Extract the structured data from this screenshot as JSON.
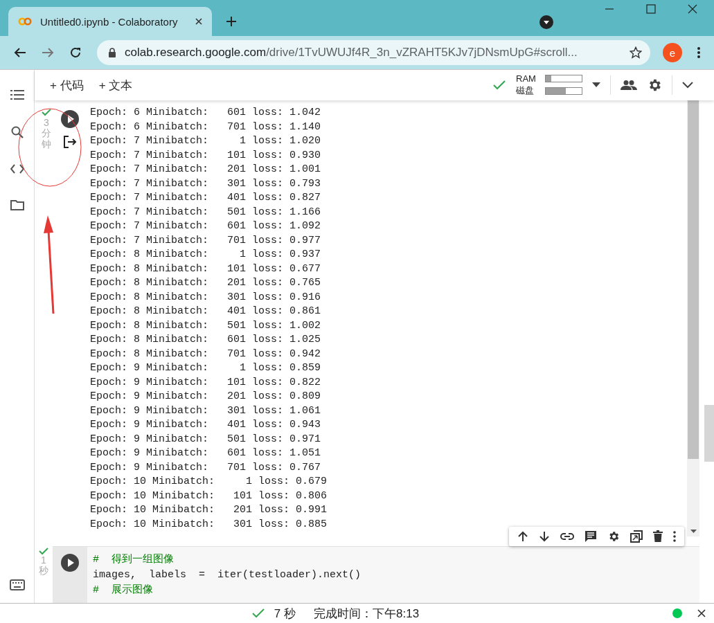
{
  "browser": {
    "tab_title": "Untitled0.ipynb - Colaboratory",
    "url_host": "colab.research.google.com",
    "url_path": "/drive/1TvUWUJf4R_3n_vZRAHT5KJv7jDNsmUpG#scroll...",
    "profile_initial": "e"
  },
  "toolbar": {
    "add_code": "+ 代码",
    "add_text": "+ 文本",
    "connected": true,
    "ram_label": "RAM",
    "ram": {
      "level": 0.15
    },
    "disk_label": "磁盘",
    "disk": {
      "level": 0.55
    }
  },
  "output_cell": {
    "done": true,
    "time": "3分钟",
    "lines": [
      "Epoch: 6 Minibatch:   601 loss: 1.042",
      "Epoch: 6 Minibatch:   701 loss: 1.140",
      "Epoch: 7 Minibatch:     1 loss: 1.020",
      "Epoch: 7 Minibatch:   101 loss: 0.930",
      "Epoch: 7 Minibatch:   201 loss: 1.001",
      "Epoch: 7 Minibatch:   301 loss: 0.793",
      "Epoch: 7 Minibatch:   401 loss: 0.827",
      "Epoch: 7 Minibatch:   501 loss: 1.166",
      "Epoch: 7 Minibatch:   601 loss: 1.092",
      "Epoch: 7 Minibatch:   701 loss: 0.977",
      "Epoch: 8 Minibatch:     1 loss: 0.937",
      "Epoch: 8 Minibatch:   101 loss: 0.677",
      "Epoch: 8 Minibatch:   201 loss: 0.765",
      "Epoch: 8 Minibatch:   301 loss: 0.916",
      "Epoch: 8 Minibatch:   401 loss: 0.861",
      "Epoch: 8 Minibatch:   501 loss: 1.002",
      "Epoch: 8 Minibatch:   601 loss: 1.025",
      "Epoch: 8 Minibatch:   701 loss: 0.942",
      "Epoch: 9 Minibatch:     1 loss: 0.859",
      "Epoch: 9 Minibatch:   101 loss: 0.822",
      "Epoch: 9 Minibatch:   201 loss: 0.809",
      "Epoch: 9 Minibatch:   301 loss: 1.061",
      "Epoch: 9 Minibatch:   401 loss: 0.943",
      "Epoch: 9 Minibatch:   501 loss: 0.971",
      "Epoch: 9 Minibatch:   601 loss: 1.051",
      "Epoch: 9 Minibatch:   701 loss: 0.767",
      "Epoch: 10 Minibatch:     1 loss: 0.679",
      "Epoch: 10 Minibatch:   101 loss: 0.806",
      "Epoch: 10 Minibatch:   201 loss: 0.991",
      "Epoch: 10 Minibatch:   301 loss: 0.885"
    ]
  },
  "code_cell": {
    "done": true,
    "time": "1秒",
    "lines": [
      {
        "kind": "comment",
        "text": "#  得到一组图像"
      },
      {
        "kind": "code",
        "text": "images,  labels  =  iter(testloader).next()"
      },
      {
        "kind": "comment",
        "text": "#  展示图像"
      }
    ]
  },
  "status_bar": {
    "done": true,
    "duration": "7 秒",
    "finished": "完成时间：下午8:13",
    "connected": true
  }
}
